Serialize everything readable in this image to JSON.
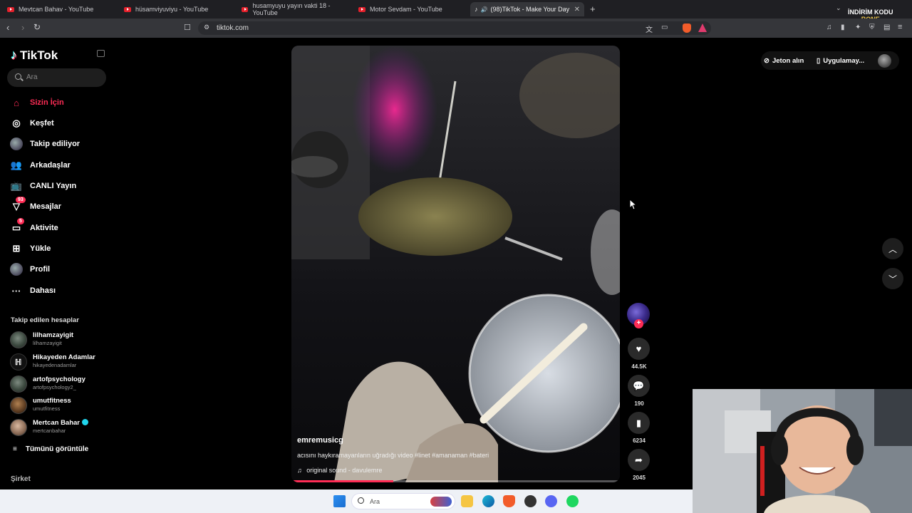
{
  "browser": {
    "tabs": [
      {
        "title": "Mevtcan Bahav - YouTube",
        "active": false
      },
      {
        "title": "hüsamviyuviyu - YouTube",
        "active": false
      },
      {
        "title": "husamyuyu yayın vakti 18 - YouTube",
        "active": false
      },
      {
        "title": "Motor Sevdam - YouTube",
        "active": false
      },
      {
        "title": "(98)TikTok - Make Your Day",
        "active": true
      }
    ],
    "new_tab": "+",
    "close": "✕",
    "url": "tiktok.com",
    "overlay_badge": {
      "line1": "İNDİRİM KODU",
      "line2": "BONE"
    }
  },
  "sidebar": {
    "logo": "TikTok",
    "search_placeholder": "Ara",
    "nav": [
      {
        "label": "Sizin İçin",
        "icon": "home-icon",
        "active": true
      },
      {
        "label": "Keşfet",
        "icon": "compass-icon"
      },
      {
        "label": "Takip ediliyor",
        "icon": "following-avatar-icon"
      },
      {
        "label": "Arkadaşlar",
        "icon": "friends-icon"
      },
      {
        "label": "CANLI Yayın",
        "icon": "live-tv-icon"
      },
      {
        "label": "Mesajlar",
        "icon": "messages-icon",
        "badge": "93"
      },
      {
        "label": "Aktivite",
        "icon": "activity-icon",
        "badge": "5"
      },
      {
        "label": "Yükle",
        "icon": "upload-icon"
      },
      {
        "label": "Profil",
        "icon": "profile-avatar-icon"
      },
      {
        "label": "Dahası",
        "icon": "more-dots-icon"
      }
    ],
    "following_title": "Takip edilen hesaplar",
    "following": [
      {
        "name": "lilhamzayigit",
        "handle": "lilhamzayigit"
      },
      {
        "name": "Hikayeden Adamlar",
        "handle": "hikayedenadamlar"
      },
      {
        "name": "artofpsychology",
        "handle": "artofpsychology2_"
      },
      {
        "name": "umutfitness",
        "handle": "umutfitness"
      },
      {
        "name": "Mertcan Bahar",
        "handle": "mertcanbahar",
        "verified": true
      }
    ],
    "see_all": "Tümünü görüntüle",
    "company": "Şirket"
  },
  "video": {
    "username": "emremusicg",
    "caption": "acısını haykıramayanların uğradığı video #linet #amanaman #bateri",
    "sound": "original sound - davulemre",
    "progress": 0.31
  },
  "actions": {
    "likes": "44.5K",
    "comments": "190",
    "saves": "6234",
    "shares": "2045"
  },
  "topbar": {
    "coins": "Jeton alın",
    "app": "Uygulamay..."
  },
  "taskbar": {
    "search_placeholder": "Ara"
  },
  "colors": {
    "accent": "#fe2c55",
    "background": "#000000"
  }
}
